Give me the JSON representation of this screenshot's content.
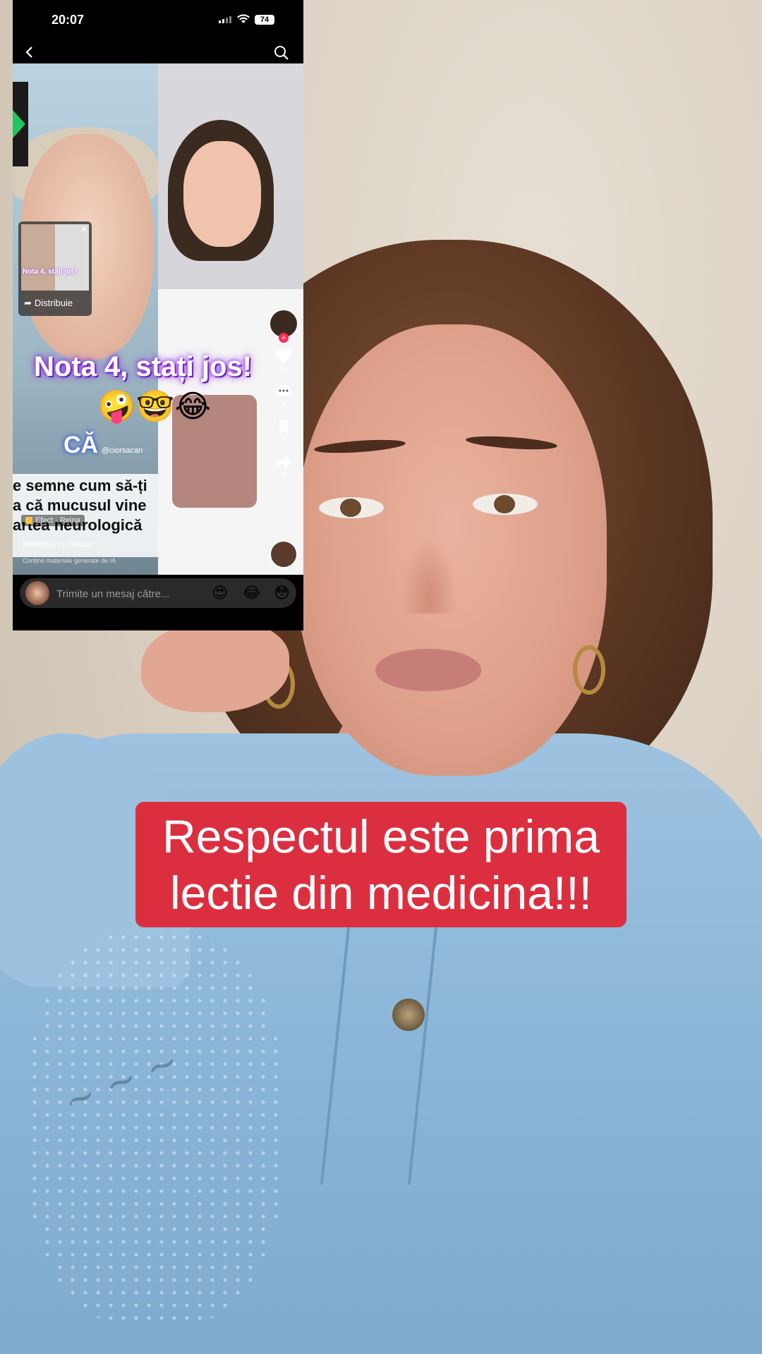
{
  "status_bar": {
    "time": "20:07",
    "battery": "74"
  },
  "overlay_video": {
    "mini_card": {
      "title": "Nota 4, stați jos!",
      "share_label": "Distribuie"
    },
    "headline": "Nota 4, stați jos!",
    "emojis": "🤪🤓😂",
    "badge": "CĂ",
    "handle": "@ciorsacan",
    "side_rail": {
      "like_count": "16",
      "comment_count": "1",
      "save_count": "1",
      "share_count": "3"
    },
    "description_lines": [
      "e semne cum să-ți",
      "a că mucusul vine",
      "artea neurologică"
    ],
    "effect": "Efect · Reina",
    "subtitle": "Medicina, nu basme!",
    "ai_note": "Conține materiale generate de IA"
  },
  "message_bar": {
    "placeholder": "Trimite un mesaj către...",
    "quick_reactions": [
      "😍",
      "😂",
      "😳"
    ]
  },
  "caption": {
    "text": "Respectul este prima lectie din medicina!!!"
  },
  "colors": {
    "caption_bg": "#db2f40",
    "headline_glow": "#8b2be2",
    "like_plus": "#fe2c55"
  }
}
